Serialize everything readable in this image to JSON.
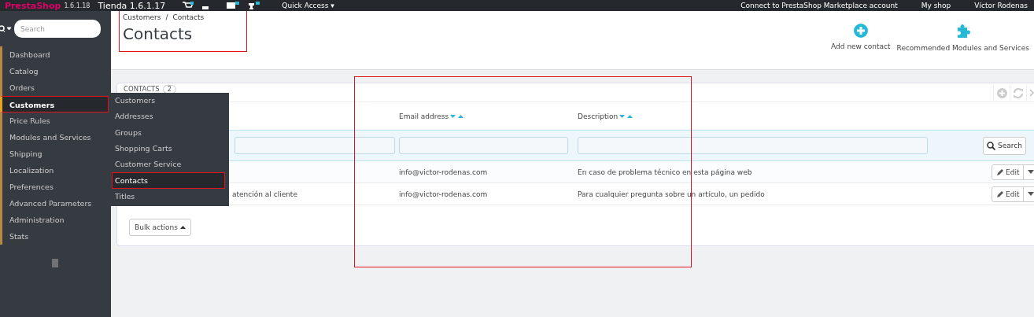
{
  "top_bar": {
    "logo": "PrestaShop",
    "version": "1.6.1.18",
    "shop_name": "Tienda 1.6.1.17",
    "quick_access": "Quick Access ▾",
    "marketplace": "Connect to PrestaShop Marketplace account",
    "my_shop": "My shop",
    "user": "Víctor Rodenas"
  },
  "sidebar": {
    "search": {
      "placeholder": "Search"
    },
    "items": [
      {
        "label": "Dashboard",
        "selected": false,
        "outlined": false
      },
      {
        "label": "Catalog",
        "selected": false,
        "outlined": false
      },
      {
        "label": "Orders",
        "selected": false,
        "outlined": false
      },
      {
        "label": "Customers",
        "selected": true,
        "outlined": true
      },
      {
        "label": "Price Rules",
        "selected": false,
        "outlined": false
      },
      {
        "label": "Modules and Services",
        "selected": false,
        "outlined": false
      },
      {
        "label": "Shipping",
        "selected": false,
        "outlined": false
      },
      {
        "label": "Localization",
        "selected": false,
        "outlined": false
      },
      {
        "label": "Preferences",
        "selected": false,
        "outlined": false
      },
      {
        "label": "Advanced Parameters",
        "selected": false,
        "outlined": false
      },
      {
        "label": "Administration",
        "selected": false,
        "outlined": false
      },
      {
        "label": "Stats",
        "selected": false,
        "outlined": false
      }
    ]
  },
  "submenu": {
    "items": [
      {
        "label": "Customers",
        "selected": false,
        "outlined": false
      },
      {
        "label": "Addresses",
        "selected": false,
        "outlined": false
      },
      {
        "label": "Groups",
        "selected": false,
        "outlined": false
      },
      {
        "label": "Shopping Carts",
        "selected": false,
        "outlined": false
      },
      {
        "label": "Customer Service",
        "selected": false,
        "outlined": false
      },
      {
        "label": "Contacts",
        "selected": true,
        "outlined": true
      },
      {
        "label": "Titles",
        "selected": false,
        "outlined": false
      }
    ]
  },
  "header": {
    "breadcrumb": [
      "Customers",
      "Contacts"
    ],
    "breadcrumb_separator": "/",
    "title": "Contacts",
    "outlined": true,
    "actions": [
      {
        "label": "Add new contact",
        "kind": "add"
      },
      {
        "label": "Recommended Modules and Services",
        "kind": "modules"
      }
    ]
  },
  "panel": {
    "title": "CONTACTS",
    "count": "2",
    "table": {
      "columns": [
        {
          "label": "Email address"
        },
        {
          "label": "Description"
        }
      ],
      "filter_button": "Search",
      "rows": [
        {
          "email": "info@victor-rodenas.com",
          "description": "En caso de problema técnico en esta página web",
          "action": "Edit"
        },
        {
          "name": "atención al cliente",
          "email": "info@victor-rodenas.com",
          "description": "Para cualquier pregunta sobre un artículo, un pedido",
          "action": "Edit"
        }
      ]
    },
    "bulk_actions": "Bulk actions"
  }
}
